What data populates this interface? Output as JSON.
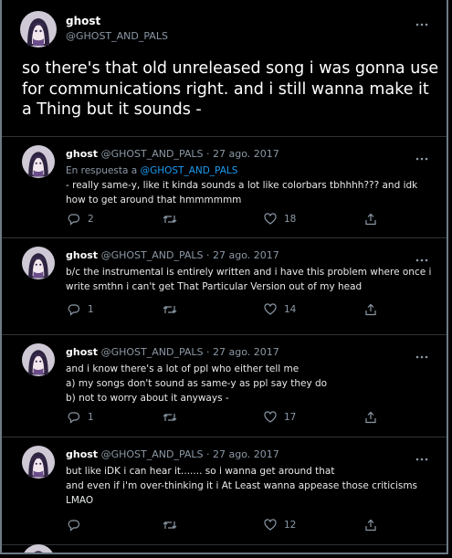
{
  "main_tweet": {
    "name": "ghost",
    "handle": "@GHOST_AND_PALS",
    "text": "so there's that old unreleased song i was gonna use for communications right. and i still wanna make it a Thing but it sounds -"
  },
  "replies": [
    {
      "name": "ghost",
      "meta": "@GHOST_AND_PALS · 27 ago. 2017",
      "in_reply_prefix": "En respuesta a ",
      "in_reply_mention": "@GHOST_AND_PALS",
      "lines": [
        "- really same-y, like it kinda sounds a lot like colorbars tbhhhh??? and idk",
        "how to get around that hmmmmmm"
      ],
      "replies_count": "2",
      "retweets_count": "",
      "likes_count": "18"
    },
    {
      "name": "ghost",
      "meta": "@GHOST_AND_PALS · 27 ago. 2017",
      "lines": [
        "b/c the instrumental is entirely written and i have this problem where once i",
        "write smthn i can't get That Particular Version out of my head"
      ],
      "replies_count": "1",
      "retweets_count": "",
      "likes_count": "14"
    },
    {
      "name": "ghost",
      "meta": "@GHOST_AND_PALS · 27 ago. 2017",
      "lines": [
        "and i know there's a lot of ppl who either tell me",
        "a) my songs don't sound as same-y as ppl say they do",
        "b) not to worry about it anyways -"
      ],
      "replies_count": "1",
      "retweets_count": "",
      "likes_count": "17"
    },
    {
      "name": "ghost",
      "meta": "@GHOST_AND_PALS · 27 ago. 2017",
      "lines": [
        "but like iDK i can hear it....... so i wanna get around that",
        "and even if i'm over-thinking it i At Least wanna appease those criticisms",
        "LMAO"
      ],
      "replies_count": "",
      "retweets_count": "",
      "likes_count": "12"
    }
  ],
  "icons": {
    "more": "more-horizontal-icon",
    "reply": "reply-icon",
    "retweet": "retweet-icon",
    "like": "heart-icon",
    "share": "share-icon"
  },
  "colors": {
    "background": "#000000",
    "text": "#e7e9ea",
    "secondary": "#8b98a5",
    "link": "#1d9bf0",
    "divider": "#2f3336"
  }
}
